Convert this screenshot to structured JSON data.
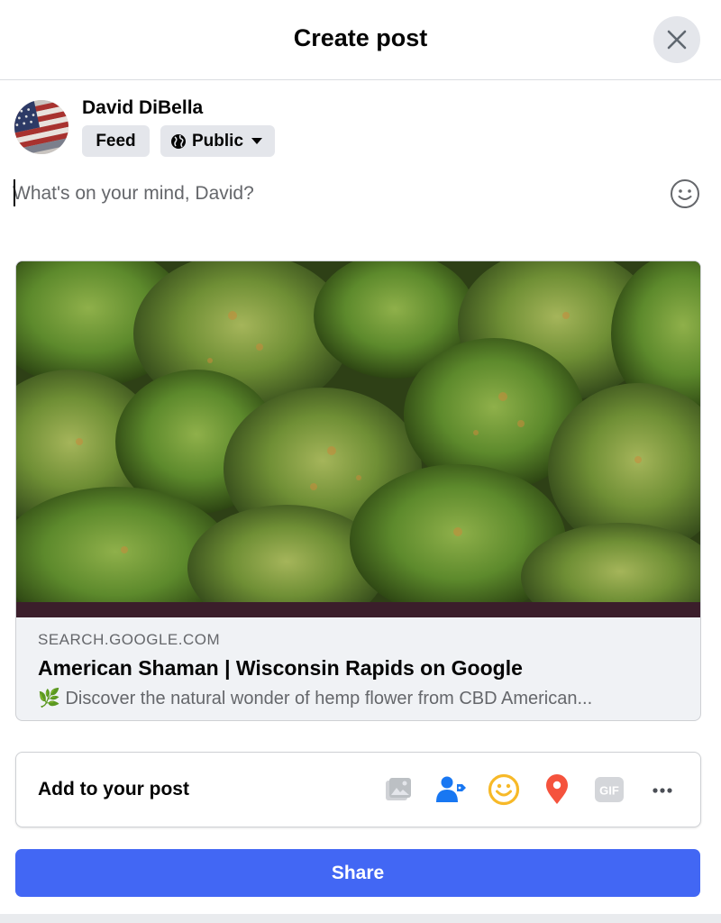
{
  "dialog": {
    "title": "Create post",
    "close_icon": "close-icon"
  },
  "user": {
    "name": "David DiBella",
    "feed_label": "Feed",
    "audience_label": "Public",
    "audience_icon": "globe-icon"
  },
  "composer": {
    "placeholder": "What's on your mind, David?",
    "value": "",
    "emoji_icon": "smiley-icon"
  },
  "link_preview": {
    "domain": "SEARCH.GOOGLE.COM",
    "title": "American Shaman | Wisconsin Rapids on Google",
    "description": "🌿 Discover the natural wonder of hemp flower from CBD American..."
  },
  "add_to_post": {
    "label": "Add to your post",
    "tools": [
      {
        "name": "photo-video-icon",
        "state": "disabled"
      },
      {
        "name": "tag-people-icon",
        "color": "#1877f2"
      },
      {
        "name": "feeling-activity-icon",
        "color": "#f7b928"
      },
      {
        "name": "check-in-icon",
        "color": "#f5533d"
      },
      {
        "name": "gif-icon",
        "state": "disabled"
      },
      {
        "name": "more-options-icon"
      }
    ]
  },
  "share": {
    "label": "Share",
    "color": "#4267f4"
  }
}
